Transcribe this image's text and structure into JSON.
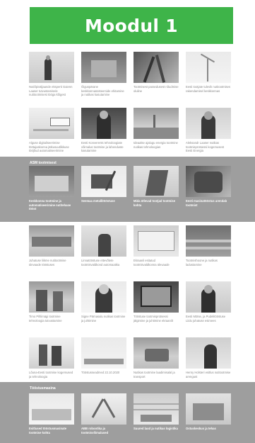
{
  "header": {
    "title": "Moodul 1"
  },
  "section1": {
    "items": [
      {
        "caption": "Nutiõpiväljaande eksperti Gaienn Laaser tutvustamisele nutitootmisest tööga kõigest"
      },
      {
        "caption": "Õiguspärane keskkonnasüsteemide ehitamine ja nutikas kasutamine"
      },
      {
        "caption": "Tootmisest parandusest nõudmise oluline"
      },
      {
        "caption": "Eesti tootjate tulevik nutitootmises rakendamisel keskkonnas"
      },
      {
        "caption": "Alguse digitaliseerimise töötajaskonna jätkusuutlikkuse tööjõud automatiseerimine"
      },
      {
        "caption": "Eesti Konverents tehnoloogiate võimalus tootmise ja lahenduste kasutamine"
      },
      {
        "caption": "Ideaalse ajalugu energia tootmine nutikas tehnoloogias"
      },
      {
        "caption": "Aleksandr Laaser nutikas tootmisprotsessi kogemusest Eesti Energia"
      }
    ]
  },
  "band1": {
    "title": "ASM tootmisest",
    "items": [
      {
        "caption": "Keskkonna tootmine ja automatiseerimine nutitehase tööst"
      },
      {
        "caption": "Seemaa metallitööstuse"
      },
      {
        "caption": "Mida ütlevad tootjad tootmise kohta"
      },
      {
        "caption": "Eesti masinatööstus arendab tootmist"
      }
    ]
  },
  "section2": {
    "items": [
      {
        "caption": "Juhatuse liikme nutitootmise ülevaade tööstuses"
      },
      {
        "caption": "Linnatööstuse ettevõtete tootmisvaldkond automaatika"
      },
      {
        "caption": "Ekraanil esitatud tootmisvaldkonna ülevaade"
      },
      {
        "caption": "Tootmishoone ja nutikas ladustamine"
      },
      {
        "caption": "Timo Pihlimägi tootmine tehnoloogia tutvustamine"
      },
      {
        "caption": "Signe Pärnasalu nutikas tootmine ja juhtimine"
      },
      {
        "caption": "Tööstuse tootmisprotsessi jälgimine ja juhtimine ekraanilt"
      },
      {
        "caption": "Eesti Mötse, ja Pudelitööstuse Liidu juhatuse esimees"
      },
      {
        "caption": "Lõuna-Eesti tootmise kogemused ja tehnoloogia"
      },
      {
        "caption": "Tööstusseadmed 22.10.2020"
      },
      {
        "caption": "Nutikas tootmine laadimisalal ja transport"
      },
      {
        "caption": "Henry Holsteri esitlus nutitootmise arengust"
      }
    ]
  },
  "band2": {
    "title": "Tööstusmasina",
    "items": [
      {
        "caption": "Esitlused tööstusmasinate tootmise kohta"
      },
      {
        "caption": "ABB robootika ja tootmisvõimalused"
      },
      {
        "caption": "Suured laod ja nutikas logistika"
      },
      {
        "caption": "Ostuskeskus ja tehas"
      }
    ]
  }
}
